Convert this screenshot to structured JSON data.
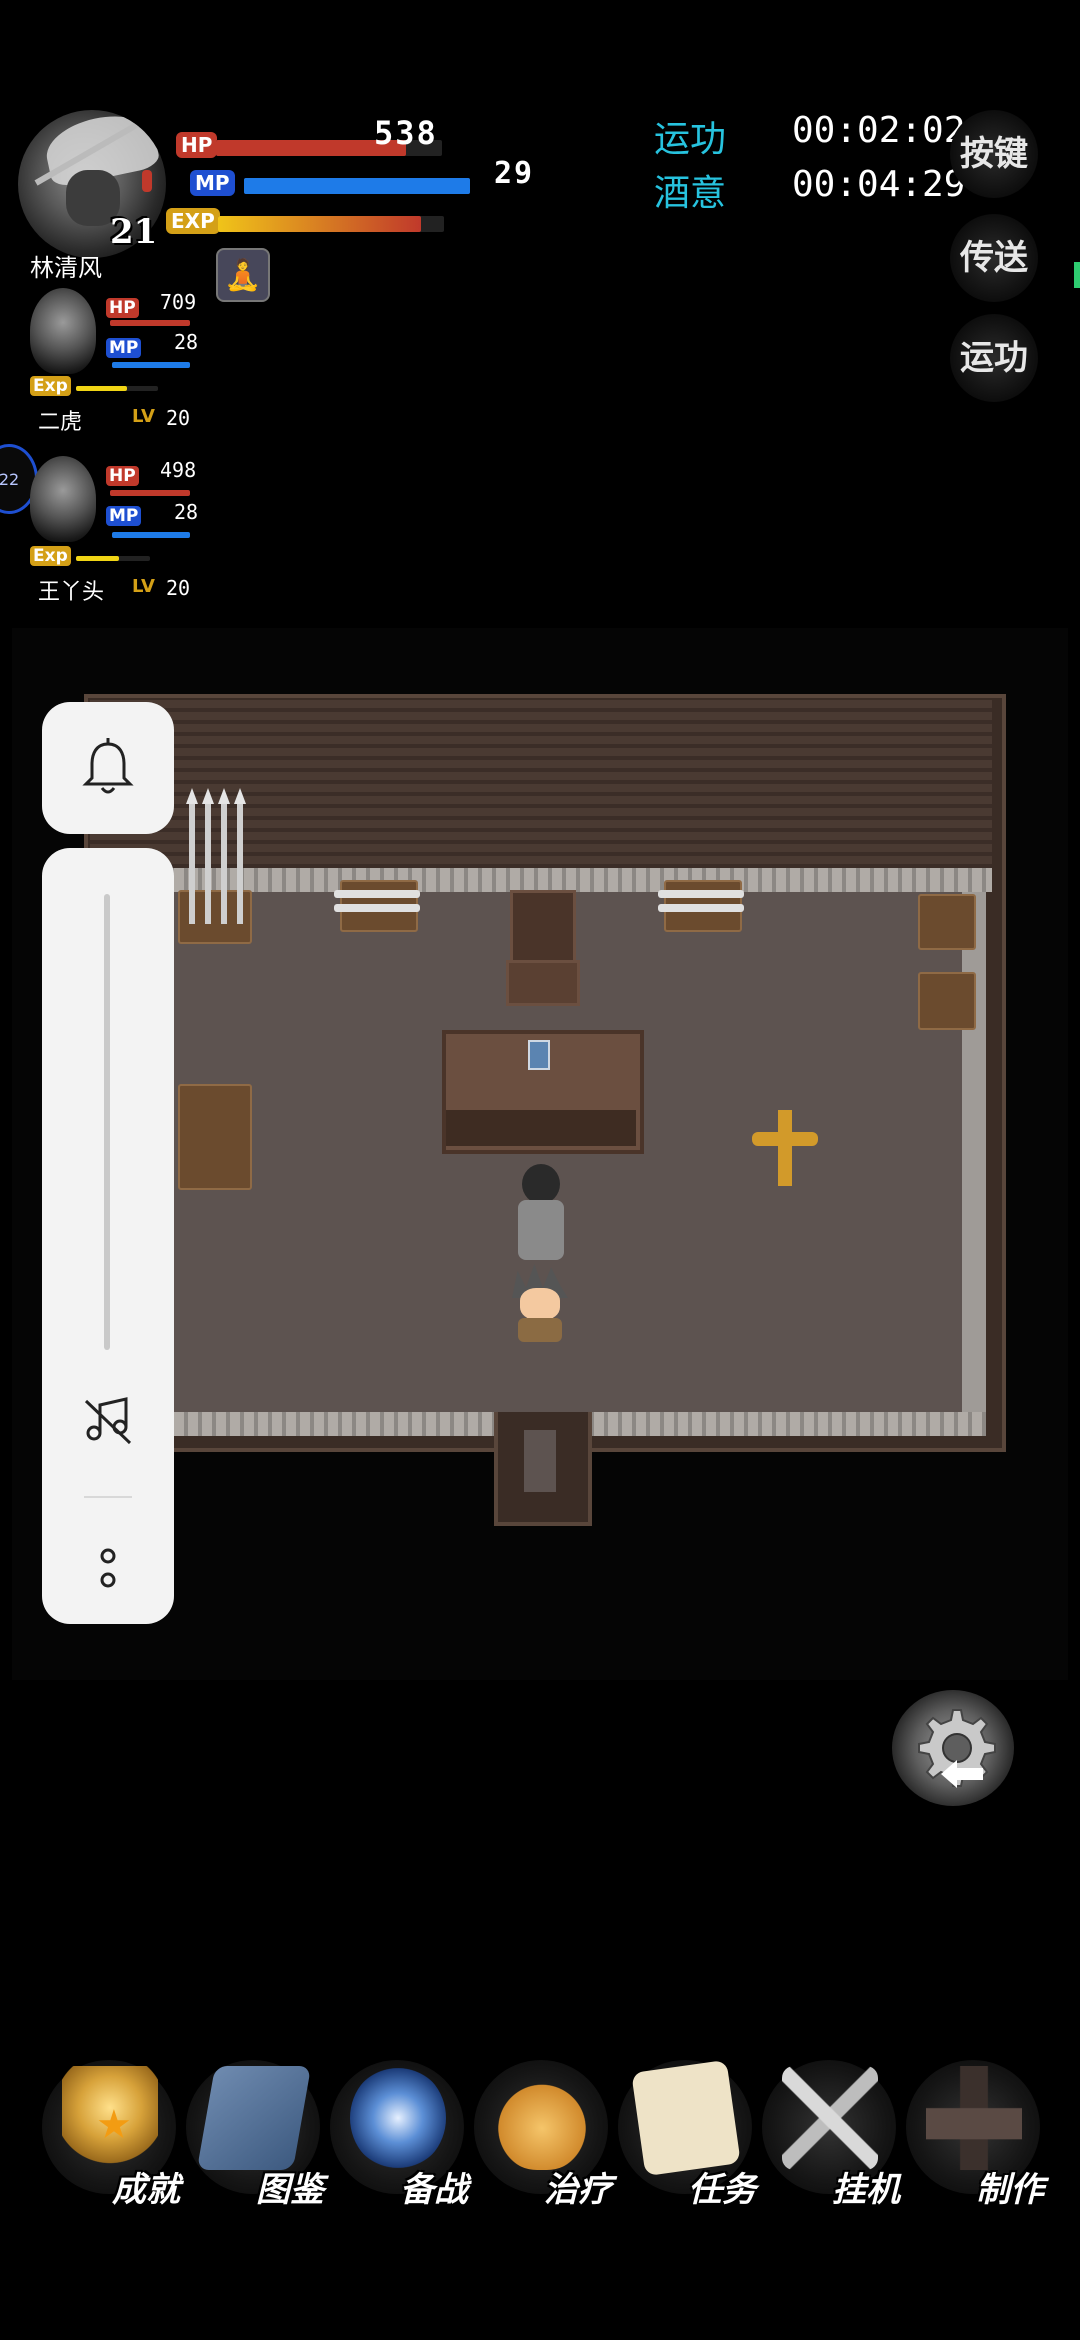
{
  "leader": {
    "name": "林清风",
    "level": "21",
    "hp_label": "HP",
    "mp_label": "MP",
    "exp_label": "EXP",
    "hp_value": "538",
    "mp_value": "29",
    "hp_fill": 0.84,
    "mp_fill": 1.0,
    "exp_fill": 0.9,
    "meditate_icon": "meditate-icon"
  },
  "party": [
    {
      "name": "二虎",
      "hp_label": "HP",
      "mp_label": "MP",
      "exp_label": "Exp",
      "lv_label": "LV",
      "hp": "709",
      "mp": "28",
      "lv": "20",
      "exp_fill": 0.62
    },
    {
      "name": "王丫头",
      "hp_label": "HP",
      "mp_label": "MP",
      "exp_label": "Exp",
      "lv_label": "LV",
      "hp": "498",
      "mp": "28",
      "lv": "20",
      "exp_fill": 0.58
    }
  ],
  "edge_badge": "22",
  "timers": [
    {
      "label": "运功",
      "value": "00:02:02"
    },
    {
      "label": "酒意",
      "value": "00:04:29"
    }
  ],
  "side_buttons": [
    {
      "label": "按键"
    },
    {
      "label": "传送"
    },
    {
      "label": "运功"
    }
  ],
  "bottom_menu": [
    {
      "label": "成就",
      "icon": "medal-icon"
    },
    {
      "label": "图鉴",
      "icon": "book-icon"
    },
    {
      "label": "备战",
      "icon": "swirl-icon"
    },
    {
      "label": "治疗",
      "icon": "gourd-icon"
    },
    {
      "label": "任务",
      "icon": "scroll-icon"
    },
    {
      "label": "挂机",
      "icon": "crossed-swords-icon"
    },
    {
      "label": "制作",
      "icon": "anvil-icon"
    }
  ],
  "colors": {
    "hp": "#c0392b",
    "mp": "#1e4fd1",
    "exp": "#d4a017",
    "timer_label": "#27c3df"
  }
}
